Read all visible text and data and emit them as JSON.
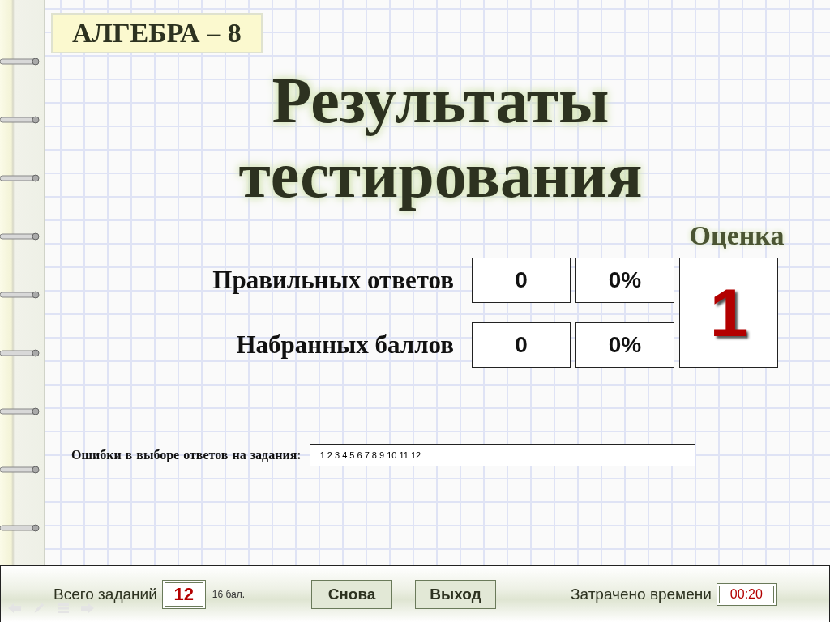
{
  "header": {
    "subject": "АЛГЕБРА – 8"
  },
  "title": [
    "Результаты",
    "тестирования"
  ],
  "grade": {
    "label": "Оценка",
    "value": "1"
  },
  "results": [
    {
      "label": "Правильных ответов",
      "count": "0",
      "percent": "0%"
    },
    {
      "label": "Набранных баллов",
      "count": "0",
      "percent": "0%"
    }
  ],
  "errors": {
    "label": "Ошибки в выборе ответов  на задания:",
    "value": "1 2 3 4 5 6 7 8 9 10 11 12"
  },
  "footer": {
    "total_label": "Всего заданий",
    "total": "12",
    "points": "16 бал.",
    "buttons": [
      "Снова",
      "Выход"
    ],
    "time_label": "Затрачено времени",
    "time": "00:20"
  }
}
